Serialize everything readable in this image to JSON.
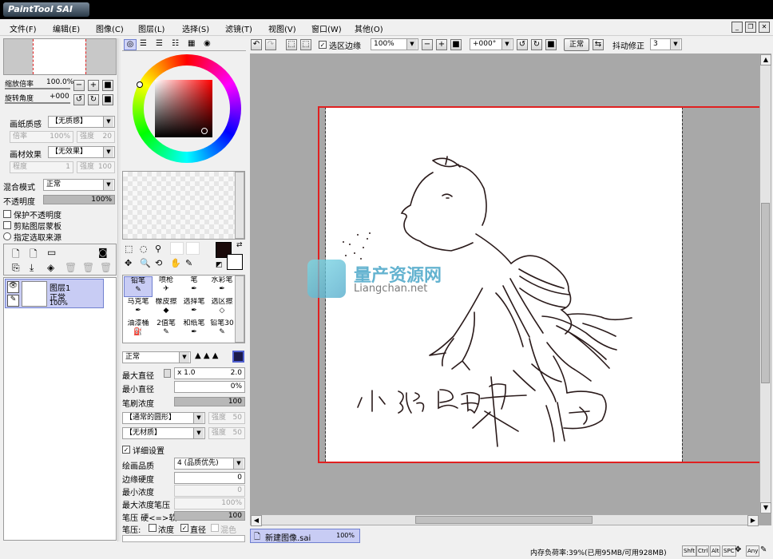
{
  "app": {
    "title": "PaintTool SAI"
  },
  "menu": [
    "文件(F)",
    "编辑(E)",
    "图像(C)",
    "图层(L)",
    "选择(S)",
    "滤镜(T)",
    "视图(V)",
    "窗口(W)",
    "其他(O)"
  ],
  "navigator": {
    "zoom_label": "缩放倍率",
    "zoom_value": "100.0%",
    "rotate_label": "旋转角度",
    "rotate_value": "+000"
  },
  "paper": {
    "texture_label": "画纸质感",
    "texture_value": "【无质感】",
    "scale_label": "倍率",
    "scale_value": "100%",
    "strength_label": "强度",
    "strength_value": "20",
    "effect_label": "画材效果",
    "effect_value": "【无效果】",
    "degree_label": "程度",
    "degree_value": "1",
    "strength2_label": "强度",
    "strength2_value": "100"
  },
  "layer_props": {
    "blend_label": "混合模式",
    "blend_value": "正常",
    "opacity_label": "不透明度",
    "opacity_value": "100%",
    "opacity_fraction": 1.0,
    "preserve_opacity": "保护不透明度",
    "clip_mask": "剪贴图层蒙板",
    "selection_source": "指定选取来源"
  },
  "layers": [
    {
      "name": "图层1",
      "mode": "正常",
      "opacity": "100%"
    }
  ],
  "color": {
    "primary": "#1a0a0a",
    "secondary": "#ffffff"
  },
  "tools": [
    {
      "label": "铅笔",
      "selected": true
    },
    {
      "label": "喷枪",
      "selected": false
    },
    {
      "label": "笔",
      "selected": false
    },
    {
      "label": "水彩笔",
      "selected": false
    },
    {
      "label": "马克笔",
      "selected": false
    },
    {
      "label": "橡皮擦",
      "selected": false
    },
    {
      "label": "选择笔",
      "selected": false
    },
    {
      "label": "选区擦",
      "selected": false
    },
    {
      "label": "油漆桶",
      "selected": false
    },
    {
      "label": "2值笔",
      "selected": false
    },
    {
      "label": "和纸笔",
      "selected": false
    },
    {
      "label": "铅笔30",
      "selected": false
    }
  ],
  "brush": {
    "mode": "正常",
    "max_size_label": "最大直径",
    "max_size_mult": "x 1.0",
    "max_size_value": "2.0",
    "min_size_label": "最小直径",
    "min_size_value": "0%",
    "density_label": "笔刷浓度",
    "density_value": "100",
    "density_fraction": 1.0,
    "shape_value": "【通常的圆形】",
    "shape_strength_label": "强度",
    "shape_strength_value": "50",
    "texture_value": "【无材质】",
    "texture_strength_label": "强度",
    "texture_strength_value": "50",
    "detail_label": "详细设置",
    "quality_label": "绘画品质",
    "quality_value": "4 (品质优先)",
    "edge_label": "边缘硬度",
    "edge_value": "0",
    "min_density_label": "最小浓度",
    "min_density_value": "0",
    "max_pressure_label": "最大浓度笔压",
    "max_pressure_value": "100%",
    "pressure_label": "笔压 硬<=>软",
    "pressure_value": "100",
    "pressure_fraction": 1.0,
    "pen_pressure_label": "笔压:",
    "density_chk": "浓度",
    "diameter_chk": "直径",
    "blend_chk": "混色"
  },
  "toolbar": {
    "selection_edge": "选区边缘",
    "zoom": "100%",
    "rotation": "+000°",
    "blend": "正常",
    "stabilizer_label": "抖动修正",
    "stabilizer_value": "3"
  },
  "watermark": {
    "title": "量产资源网",
    "url": "Liangchan.net"
  },
  "doc_tab": {
    "name": "新建图像.sai",
    "zoom": "100%"
  },
  "status": {
    "memory": "内存负荷率:39%(已用95MB/可用928MB)",
    "keys": [
      "Shft",
      "Ctrl",
      "Alt",
      "SPC",
      "Any"
    ]
  }
}
